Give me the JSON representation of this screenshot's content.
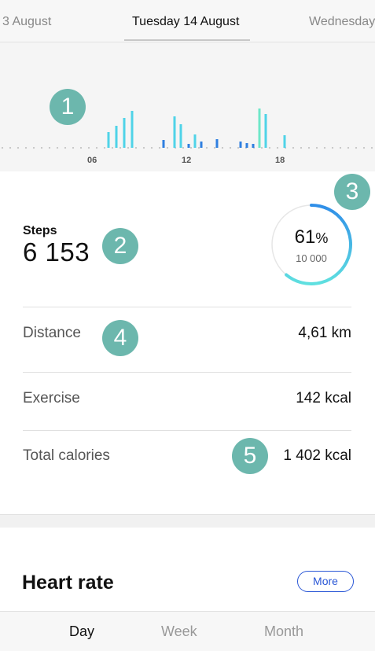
{
  "date_nav": {
    "prev": "3 August",
    "current": "Tuesday 14 August",
    "next": "Wednesday"
  },
  "chart_data": {
    "type": "bar",
    "x_ticks": [
      "06",
      "12",
      "18"
    ],
    "bars": [
      {
        "hour": 7.0,
        "value": 0.2,
        "color": "#4fd3e8"
      },
      {
        "hour": 7.5,
        "value": 0.28,
        "color": "#4fd3e8"
      },
      {
        "hour": 8.0,
        "value": 0.38,
        "color": "#4fd3e8"
      },
      {
        "hour": 8.5,
        "value": 0.47,
        "color": "#4fd3e8"
      },
      {
        "hour": 10.5,
        "value": 0.1,
        "color": "#2f7fe0"
      },
      {
        "hour": 11.2,
        "value": 0.4,
        "color": "#4fd3e8"
      },
      {
        "hour": 11.6,
        "value": 0.3,
        "color": "#4fd3e8"
      },
      {
        "hour": 12.1,
        "value": 0.05,
        "color": "#2f7fe0"
      },
      {
        "hour": 12.5,
        "value": 0.17,
        "color": "#4fd3e8"
      },
      {
        "hour": 12.9,
        "value": 0.08,
        "color": "#2f7fe0"
      },
      {
        "hour": 13.9,
        "value": 0.11,
        "color": "#2f7fe0"
      },
      {
        "hour": 15.4,
        "value": 0.08,
        "color": "#2f7fe0"
      },
      {
        "hour": 15.8,
        "value": 0.06,
        "color": "#2f7fe0"
      },
      {
        "hour": 16.2,
        "value": 0.05,
        "color": "#2f7fe0"
      },
      {
        "hour": 16.6,
        "value": 0.5,
        "color": "#6ee7c9"
      },
      {
        "hour": 17.0,
        "value": 0.43,
        "color": "#4fd3e8"
      },
      {
        "hour": 18.2,
        "value": 0.16,
        "color": "#4fd3e8"
      }
    ]
  },
  "badges": [
    "1",
    "2",
    "3",
    "4",
    "5"
  ],
  "steps": {
    "label": "Steps",
    "value": "6 153",
    "percent": "61",
    "percent_sign": "%",
    "goal": "10 000",
    "progress_fraction": 0.61,
    "ring_colors": {
      "start": "#2f8ee8",
      "end": "#5fe0e0",
      "track": "#e6e6e6"
    }
  },
  "rows": [
    {
      "label": "Distance",
      "value": "4,61 km"
    },
    {
      "label": "Exercise",
      "value": "142 kcal"
    },
    {
      "label": "Total calories",
      "value": "1 402 kcal"
    }
  ],
  "heart_rate": {
    "title": "Heart rate",
    "more_label": "More"
  },
  "tabs": [
    "Day",
    "Week",
    "Month"
  ],
  "active_tab": "Day",
  "colors": {
    "badge": "#6cb7ad",
    "more_button": "#2a57d6"
  }
}
